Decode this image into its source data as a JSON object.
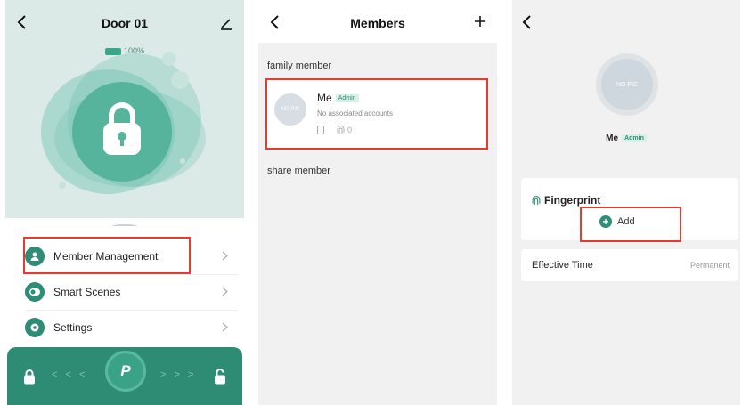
{
  "screen_door": {
    "title": "Door 01",
    "battery_text": "100%",
    "menu": [
      {
        "label": "Member Management"
      },
      {
        "label": "Smart Scenes"
      },
      {
        "label": "Settings"
      }
    ],
    "bottom_bar": {
      "left_arrows": "< < <",
      "right_arrows": "> > >",
      "center_label": "P"
    }
  },
  "screen_members": {
    "title": "Members",
    "family_section": "family member",
    "share_section": "share member",
    "member": {
      "name": "Me",
      "badge": "Admin",
      "subtitle": "No associated accounts",
      "avatar_text": "NO PIC",
      "fingerprint_count": "0"
    }
  },
  "screen_detail": {
    "avatar_text": "NO PIC",
    "name": "Me",
    "badge": "Admin",
    "fingerprint_title": "Fingerprint",
    "add_label": "Add",
    "effective_label": "Effective Time",
    "effective_value": "Permanent"
  },
  "colors": {
    "accent": "#2f8c76",
    "highlight": "#e53b33",
    "door_bg": "#dceae7"
  }
}
